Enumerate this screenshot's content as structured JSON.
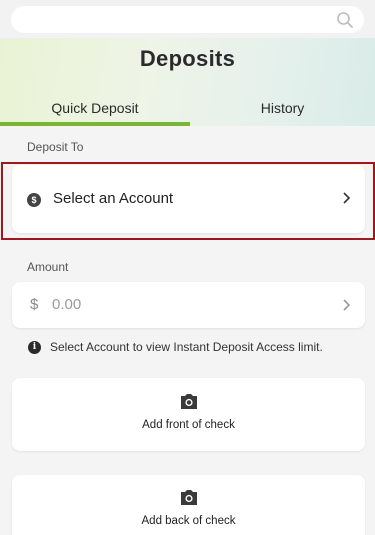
{
  "search": {
    "placeholder": ""
  },
  "header": {
    "title": "Deposits"
  },
  "tabs": [
    {
      "label": "Quick Deposit",
      "active": true
    },
    {
      "label": "History",
      "active": false
    }
  ],
  "deposit_to": {
    "label": "Deposit To",
    "selector_text": "Select an Account",
    "icon": "dollar-circle-icon"
  },
  "amount": {
    "label": "Amount",
    "currency_symbol": "$",
    "placeholder": "0.00"
  },
  "info": {
    "text": "Select Account to view Instant Deposit Access limit."
  },
  "check_front": {
    "label": "Add front of check",
    "icon": "camera-icon"
  },
  "check_back": {
    "label": "Add back of check",
    "icon": "camera-icon"
  },
  "colors": {
    "accent_green": "#7bb535",
    "highlight_red": "#a01818"
  }
}
